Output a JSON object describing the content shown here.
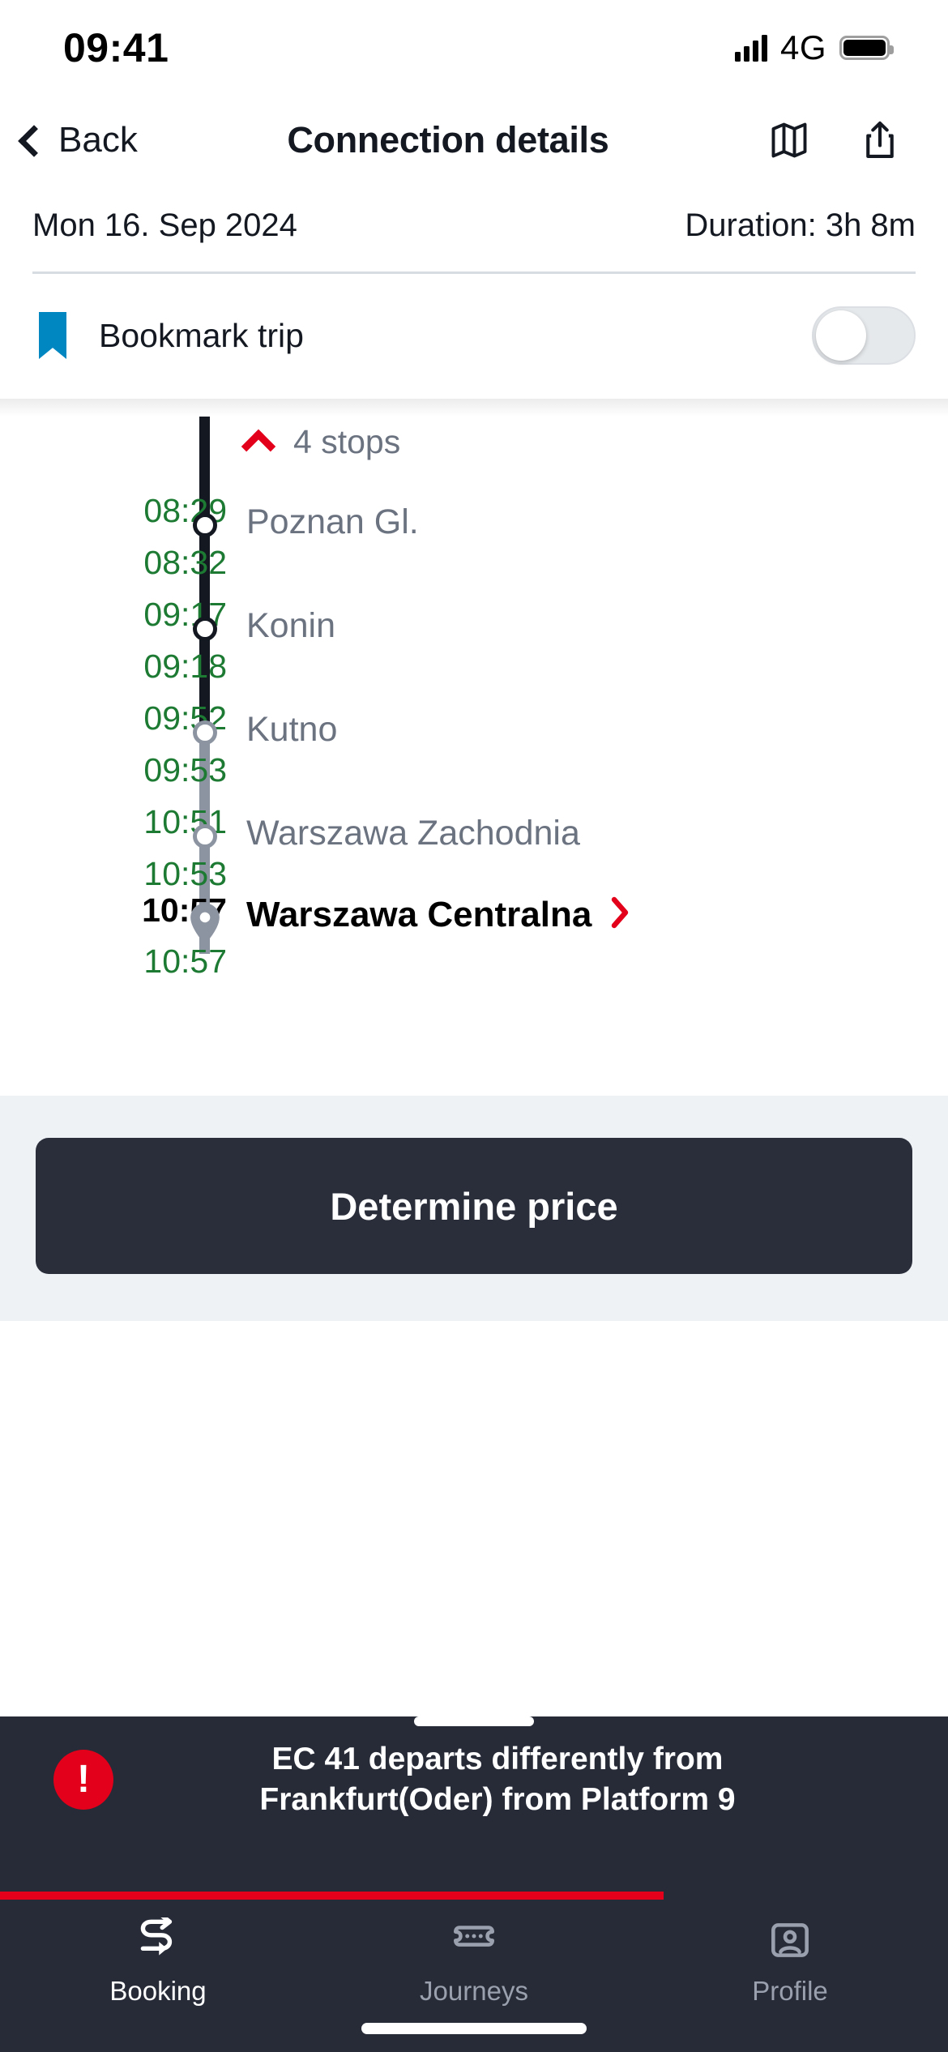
{
  "status_bar": {
    "time": "09:41",
    "network": "4G",
    "signal_icon": "cellular-signal-icon",
    "battery_icon": "battery-full-icon"
  },
  "nav": {
    "back_label": "Back",
    "back_icon": "chevron-left-icon",
    "title": "Connection details",
    "map_icon": "map-icon",
    "share_icon": "share-icon"
  },
  "summary": {
    "date": "Mon 16. Sep 2024",
    "duration": "Duration: 3h 8m"
  },
  "bookmark": {
    "icon": "bookmark-icon",
    "label": "Bookmark trip",
    "toggle_state": "off"
  },
  "journey": {
    "stops_toggle": {
      "label": "4 stops",
      "icon": "chevron-up-icon"
    },
    "stops": [
      {
        "arrival": "08:29",
        "departure": "08:32",
        "name": "Poznan Gl.",
        "marker": "circle-dark",
        "segment": "dark"
      },
      {
        "arrival": "09:17",
        "departure": "09:18",
        "name": "Konin",
        "marker": "circle-dark",
        "segment": "dark"
      },
      {
        "arrival": "09:52",
        "departure": "09:53",
        "name": "Kutno",
        "marker": "circle-grey",
        "segment": "grey"
      },
      {
        "arrival": "10:51",
        "departure": "10:53",
        "name": "Warszawa Zachodnia",
        "marker": "circle-grey",
        "segment": "grey"
      },
      {
        "arrival": "10:57",
        "departure": "10:57",
        "name": "Warszawa Centralna",
        "marker": "map-pin-grey",
        "segment": "end",
        "final": true,
        "chevron_icon": "chevron-right-icon"
      }
    ]
  },
  "price": {
    "button_label": "Determine price"
  },
  "toast": {
    "icon": "alert-exclamation-icon",
    "line1": "EC 41 departs differently from",
    "line2": "Frankfurt(Oder) from Platform 9",
    "progress_percent": 70
  },
  "tabbar": {
    "items": [
      {
        "label": "Booking",
        "icon": "route-arrows-icon",
        "active": true
      },
      {
        "label": "Journeys",
        "icon": "ticket-icon",
        "active": false
      },
      {
        "label": "Profile",
        "icon": "profile-frame-icon",
        "active": false
      }
    ]
  },
  "colors": {
    "accent_red": "#e2001a",
    "bookmark_blue": "#0087c1",
    "time_green": "#1d7a33",
    "dark": "#272b38",
    "muted": "#6b7280"
  }
}
